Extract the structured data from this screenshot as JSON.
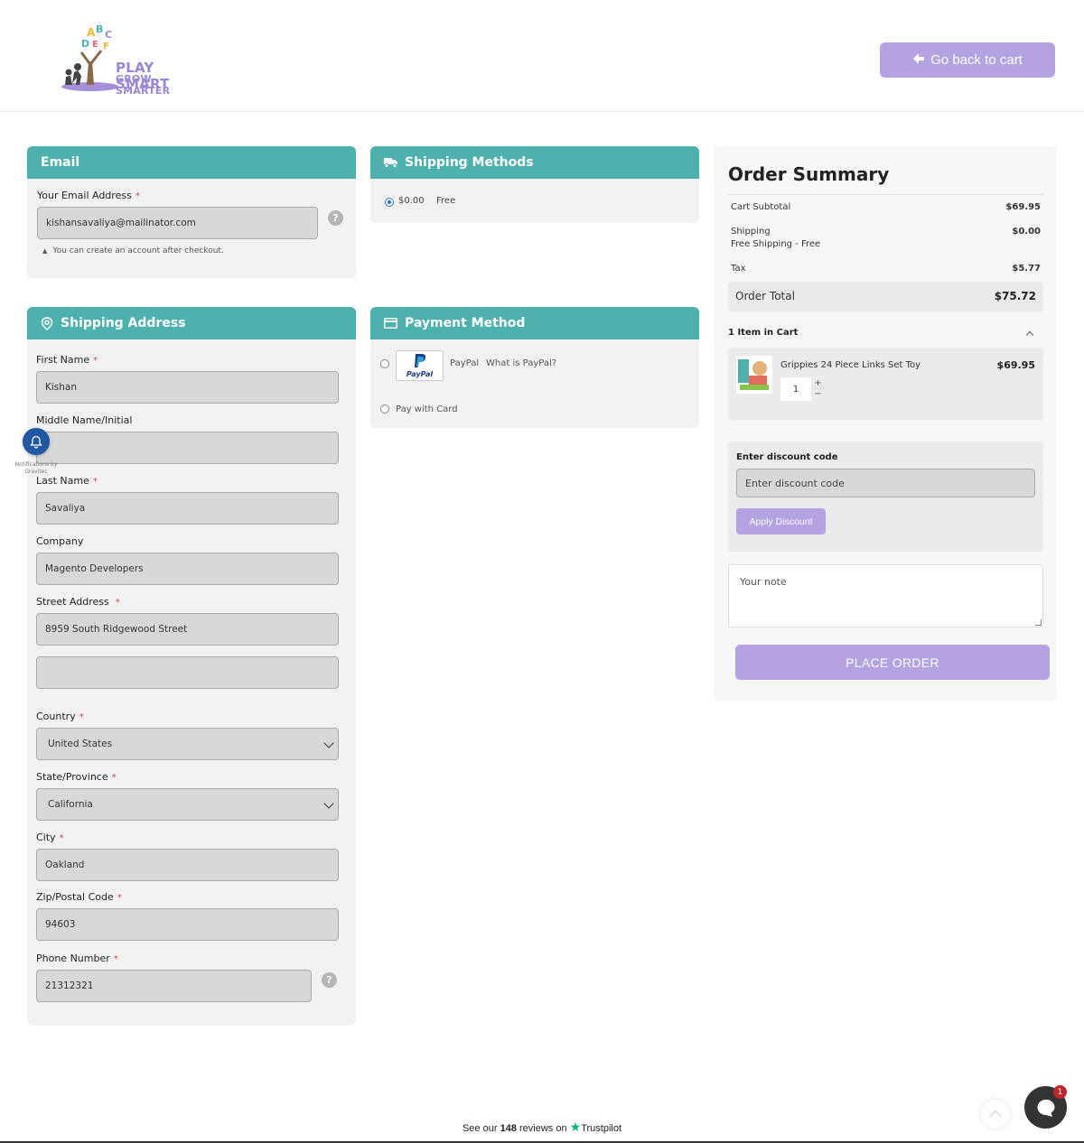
{
  "header": {
    "logo_line1": "PLAY SMART",
    "logo_line2": "GROW SMARTER",
    "back_label": "Go back to cart"
  },
  "email": {
    "title": "Email",
    "label": "Your Email Address",
    "value": "kishansavaliya@mailinator.com",
    "hint": "You can create an account after checkout."
  },
  "shipping_methods": {
    "title": "Shipping Methods",
    "price": "$0.00",
    "name": "Free"
  },
  "shipping_address": {
    "title": "Shipping Address",
    "first_name_label": "First Name",
    "first_name": "Kishan",
    "middle_label": "Middle Name/Initial",
    "middle": "",
    "last_name_label": "Last Name",
    "last_name": "Savaliya",
    "company_label": "Company",
    "company": "Magento Developers",
    "street_label": "Street Address",
    "street1": "8959 South Ridgewood Street",
    "street2": "",
    "country_label": "Country",
    "country": "United States",
    "state_label": "State/Province",
    "state": "California",
    "city_label": "City",
    "city": "Oakland",
    "zip_label": "Zip/Postal Code",
    "zip": "94603",
    "phone_label": "Phone Number",
    "phone": "21312321"
  },
  "payment": {
    "title": "Payment Method",
    "paypal_label": "PayPal",
    "paypal_logo": "PayPal",
    "paypal_link": "What is PayPal?",
    "card_label": "Pay with Card"
  },
  "summary": {
    "title": "Order Summary",
    "subtotal_label": "Cart Subtotal",
    "subtotal": "$69.95",
    "shipping_label": "Shipping",
    "shipping_sub": "Free Shipping - Free",
    "shipping": "$0.00",
    "tax_label": "Tax",
    "tax": "$5.77",
    "total_label": "Order Total",
    "total": "$75.72",
    "items_label": "1 Item in Cart",
    "item_name": "Grippies 24 Piece Links Set Toy",
    "item_price": "$69.95",
    "item_qty": "1",
    "discount_label": "Enter discount code",
    "discount_placeholder": "Enter discount code",
    "apply_label": "Apply Discount",
    "note_placeholder": "Your note",
    "place_order": "PLACE ORDER"
  },
  "notification": {
    "caption": "Notifications by Gravitec"
  },
  "footer": {
    "trust_prefix": "See our",
    "trust_count": "148",
    "trust_mid": "reviews on",
    "trust_brand": "Trustpilot",
    "chat_badge": "1"
  }
}
